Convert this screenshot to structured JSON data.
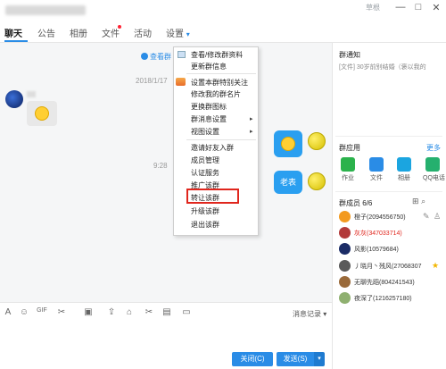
{
  "window": {
    "user_label": "草根",
    "minimize": "—",
    "maximize": "□",
    "close": "✕"
  },
  "tabs": [
    {
      "label": "聊天"
    },
    {
      "label": "公告"
    },
    {
      "label": "相册"
    },
    {
      "label": "文件"
    },
    {
      "label": "活动"
    },
    {
      "label": "设置"
    }
  ],
  "settings_caret": "▾",
  "chat": {
    "announce_link": "查看群",
    "timestamp1": "2018/1/17",
    "timestamp2": "9:28",
    "bubble_text": "老表"
  },
  "settings_menu": {
    "items": [
      {
        "label": "查看/修改群资料"
      },
      {
        "label": "更新群信息"
      },
      {
        "label": "设置本群特别关注"
      },
      {
        "label": "修改我的群名片"
      },
      {
        "label": "更换群图标"
      },
      {
        "label": "群消息设置",
        "submenu": true
      },
      {
        "label": "视图设置",
        "submenu": true
      },
      {
        "label": "邀请好友入群"
      },
      {
        "label": "成员管理"
      },
      {
        "label": "认证服务"
      },
      {
        "label": "推广该群"
      },
      {
        "label": "转让该群"
      },
      {
        "label": "升级该群"
      },
      {
        "label": "退出该群"
      }
    ],
    "submenu_arrow": "▸",
    "check": "✓"
  },
  "right_panel": {
    "notice_title": "群通知",
    "notice_text": "[文件] 30岁前别结婚（褒以我的",
    "apps_title": "群应用",
    "apps_more": "更多",
    "apps": [
      {
        "label": "作业",
        "color": "#2bb24c"
      },
      {
        "label": "文件",
        "color": "#2a8ce6"
      },
      {
        "label": "相册",
        "color": "#1ba5e0"
      },
      {
        "label": "QQ电话",
        "color": "#25b06e"
      }
    ],
    "members_title": "群成员 6/6",
    "members": [
      {
        "name": "橙子(2094556750)",
        "red": false,
        "color": "#f39a1f"
      },
      {
        "name": "灰灰(347033714)",
        "red": true,
        "color": "#b23a3a"
      },
      {
        "name": "风影(10579684)",
        "red": false,
        "color": "#1b2c66"
      },
      {
        "name": "丿晓月丶残风(27068307",
        "red": false,
        "color": "#5a5a5a",
        "star": true
      },
      {
        "name": "无聊先蹈(804241543)",
        "red": false,
        "color": "#9a6a3a"
      },
      {
        "name": "夜深了(1216257180)",
        "red": false,
        "color": "#8fb070"
      }
    ]
  },
  "toolbar": {
    "message_record": "消息记录 ▾"
  },
  "buttons": {
    "close": "关闭(C)",
    "send": "发送(S)",
    "send_arrow": "▾"
  }
}
